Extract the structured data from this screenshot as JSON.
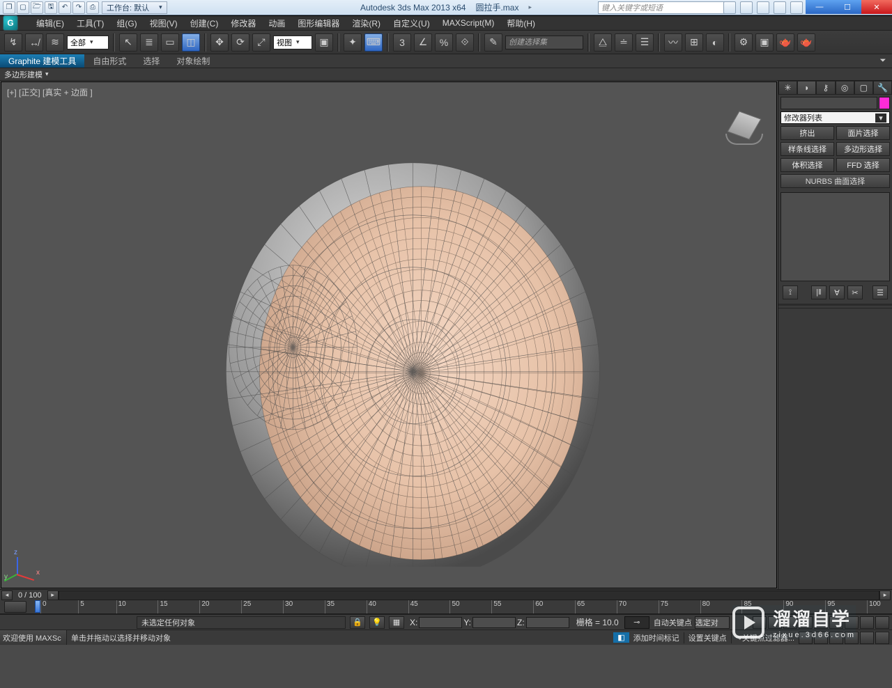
{
  "title_bar": {
    "app_title": "Autodesk 3ds Max  2013 x64",
    "file_name": "圆拉手.max",
    "workspace_label": "工作台: 默认",
    "search_placeholder": "键入关键字或短语",
    "qat": [
      "❐",
      "▢",
      "🗁",
      "🖫",
      "↶",
      "↷",
      "⎙"
    ]
  },
  "menu": {
    "items": [
      "编辑(E)",
      "工具(T)",
      "组(G)",
      "视图(V)",
      "创建(C)",
      "修改器",
      "动画",
      "图形编辑器",
      "渲染(R)",
      "自定义(U)",
      "MAXScript(M)",
      "帮助(H)"
    ]
  },
  "toolbar": {
    "selection_filter": "全部",
    "ref_coord": "视图",
    "named_set_placeholder": "创建选择集",
    "x_label": "X:",
    "y_label": "Y:",
    "z_label": "Z:"
  },
  "ribbon": {
    "tabs": [
      "Graphite 建模工具",
      "自由形式",
      "选择",
      "对象绘制"
    ],
    "sub": "多边形建模"
  },
  "viewport": {
    "label": "[+] [正交] [真实 + 边面 ]",
    "axis": {
      "x": "x",
      "y": "y",
      "z": "z"
    }
  },
  "command_panel": {
    "modifier_list": "修改器列表",
    "buttons": [
      "挤出",
      "面片选择",
      "样条线选择",
      "多边形选择",
      "体积选择",
      "FFD 选择"
    ],
    "nurbs": "NURBS 曲面选择"
  },
  "timeline": {
    "position": "0 / 100",
    "ticks": [
      "0",
      "5",
      "10",
      "15",
      "20",
      "25",
      "30",
      "35",
      "40",
      "45",
      "50",
      "55",
      "60",
      "65",
      "70",
      "75",
      "80",
      "85",
      "90",
      "95",
      "100"
    ]
  },
  "status": {
    "no_selection": "未选定任何对象",
    "hint": "单击并拖动以选择并移动对象",
    "grid": "栅格 = 10.0",
    "auto_key": "自动关键点",
    "selected_set": "选定对",
    "welcome": "欢迎使用  MAXSc",
    "add_tag": "添加时间标记",
    "set_key": "设置关键点",
    "key_filter": "关键点过滤器..."
  },
  "watermark": {
    "cn": "溜溜自学",
    "en": "zixue.3d66.com"
  }
}
